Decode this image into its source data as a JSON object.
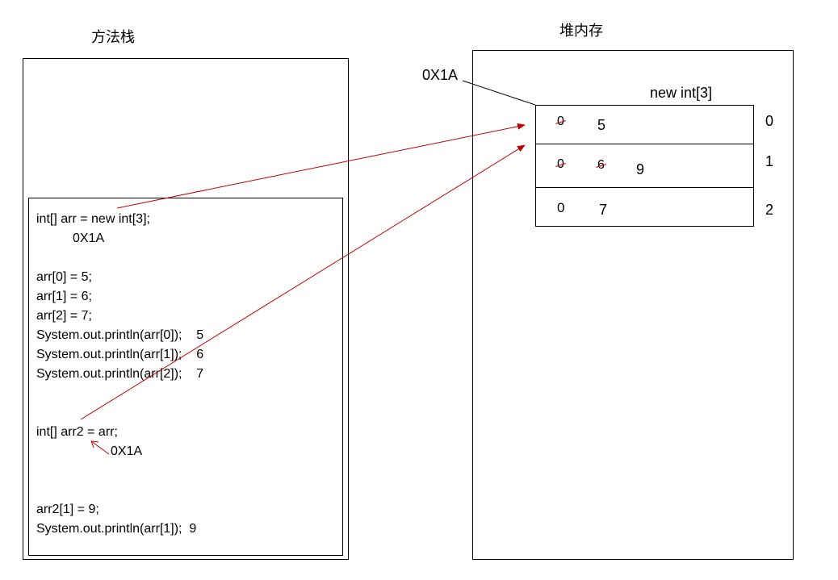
{
  "titles": {
    "stack": "方法栈",
    "heap": "堆内存"
  },
  "address_label": "0X1A",
  "array_decl": "new int[3]",
  "code": {
    "line1": "int[] arr = new int[3];",
    "addr1": "0X1A",
    "a0": "arr[0] = 5;",
    "a1": "arr[1] = 6;",
    "a2": "arr[2] = 7;",
    "p0": "System.out.println(arr[0]);",
    "p0v": "5",
    "p1": "System.out.println(arr[1]);",
    "p1v": "6",
    "p2": "System.out.println(arr[2]);",
    "p2v": "7",
    "arr2decl": "int[] arr2 = arr;",
    "addr2": "0X1A",
    "arr2assign": "arr2[1] = 9;",
    "p3": "System.out.println(arr[1]);",
    "p3v": "9"
  },
  "heap_cells": {
    "row0": {
      "old": "0",
      "val": "5",
      "index": "0"
    },
    "row1": {
      "old": "0",
      "mid": "6",
      "val": "9",
      "index": "1"
    },
    "row2": {
      "old": "0",
      "val": "7",
      "index": "2"
    }
  }
}
